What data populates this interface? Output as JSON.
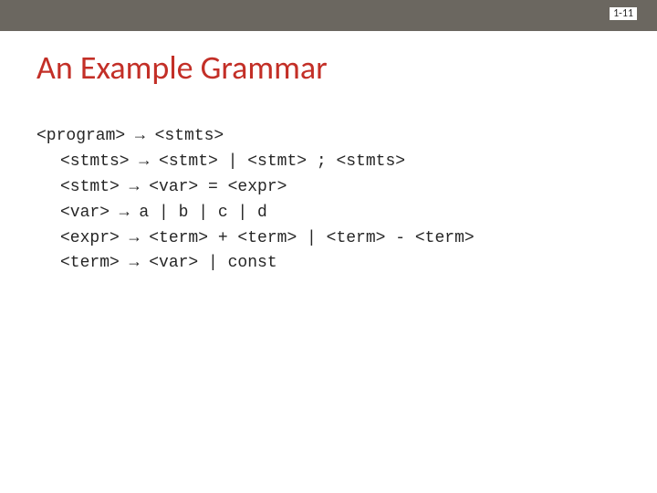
{
  "page_number": "1-11",
  "title": "An Example Grammar",
  "grammar": [
    "<program> → <stmts>",
    "<stmts> → <stmt> | <stmt> ; <stmts>",
    "<stmt> → <var> = <expr>",
    "<var> → a | b | c | d",
    "<expr> → <term> + <term> | <term> - <term>",
    "<term> → <var> | const"
  ]
}
